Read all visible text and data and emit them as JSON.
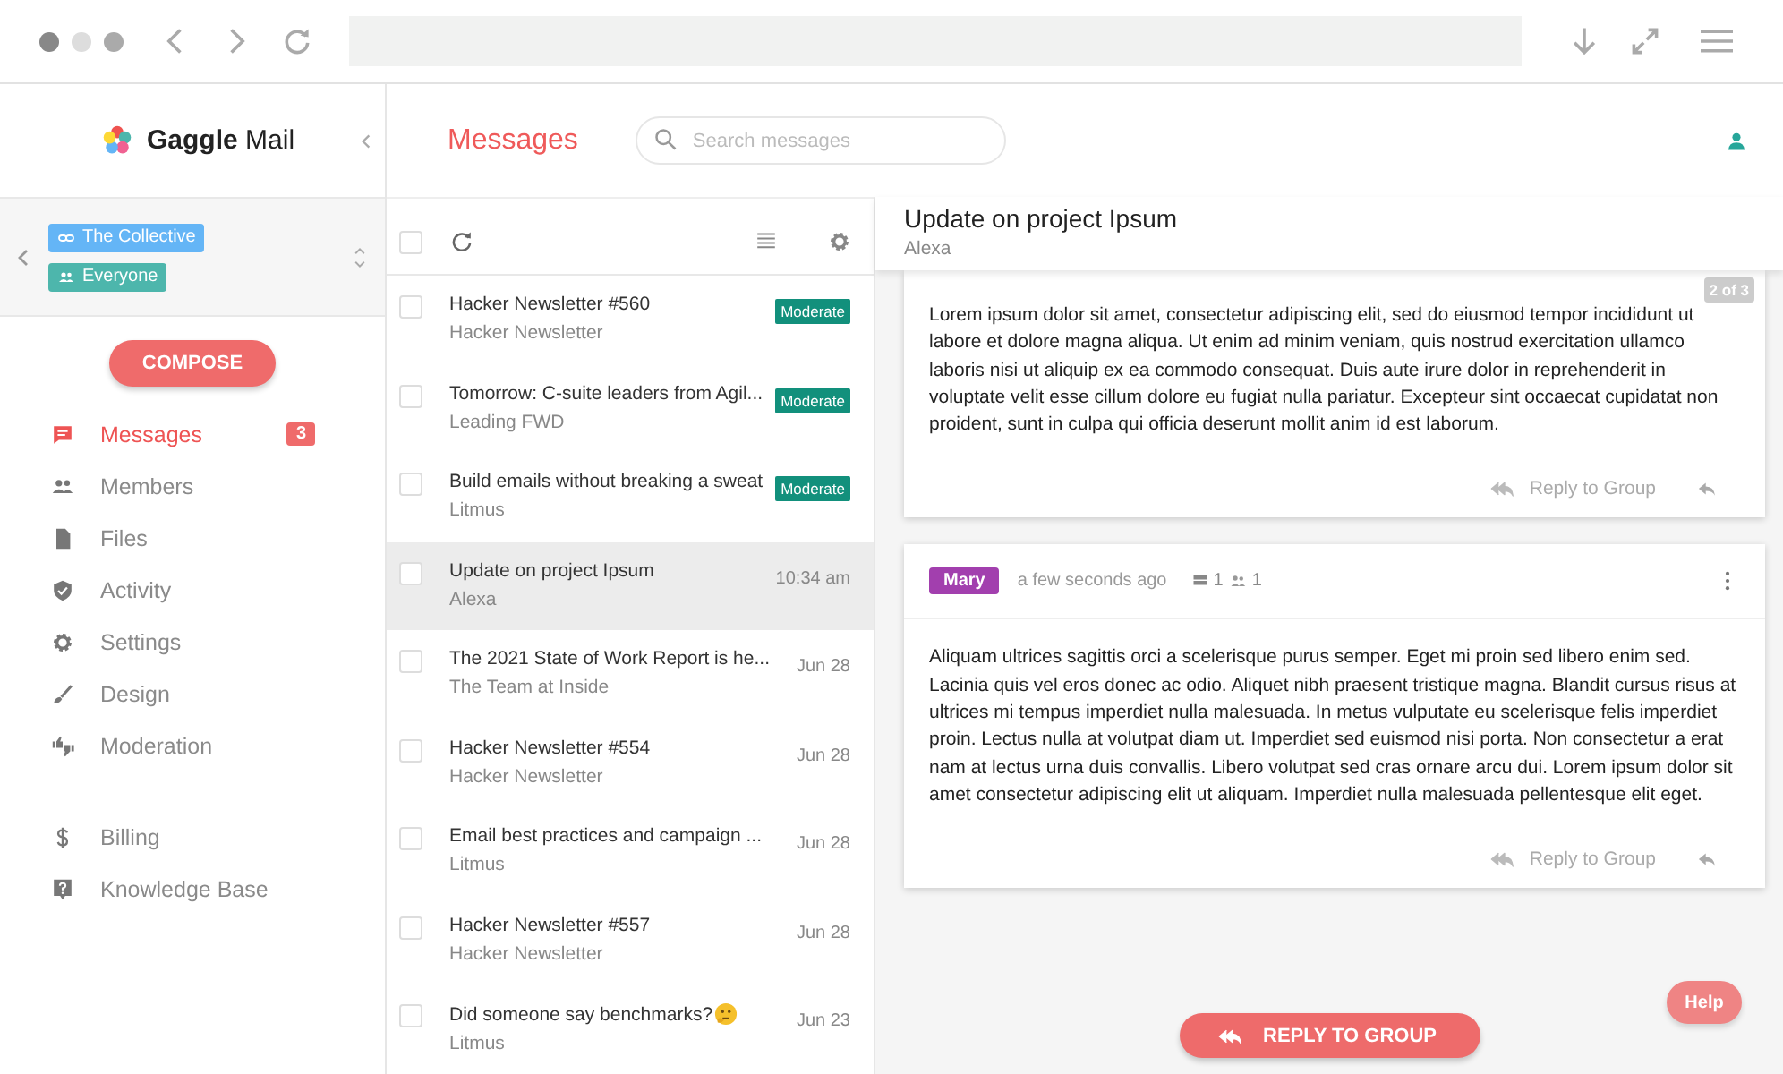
{
  "sidebar": {
    "logo": "**Gaggle** Mail",
    "groups": [
      {
        "label": "The Collective",
        "kind": "link",
        "color": "#64b5f6"
      },
      {
        "label": "Everyone",
        "kind": "people",
        "color": "#4db6ac"
      }
    ],
    "compose": "COMPOSE",
    "nav": [
      {
        "label": "Messages",
        "kind": "message",
        "selected": true,
        "badge": "3"
      },
      {
        "label": "Members",
        "kind": "people",
        "selected": false
      },
      {
        "label": "Files",
        "kind": "file",
        "selected": false
      },
      {
        "label": "Activity",
        "kind": "shield",
        "selected": false
      },
      {
        "label": "Settings",
        "kind": "gear",
        "selected": false
      },
      {
        "label": "Design",
        "kind": "brush",
        "selected": false
      },
      {
        "label": "Moderation",
        "kind": "thumbs",
        "selected": false
      }
    ],
    "nav_secondary": [
      {
        "label": "Billing",
        "kind": "dollar",
        "selected": false
      },
      {
        "label": "Knowledge Base",
        "kind": "help",
        "selected": false
      }
    ]
  },
  "topbar": {
    "title": "Messages",
    "search": {
      "placeholder": "Search messages"
    }
  },
  "message_list": {
    "select_all": {
      "checked": false
    },
    "rows": [
      {
        "subject": "Hacker Newsletter #560",
        "sender": "Hacker Newsletter",
        "tag": "Moderate",
        "checked": false,
        "selected": false
      },
      {
        "subject": "Tomorrow: C-suite leaders from Agil...",
        "sender": "Leading FWD",
        "tag": "Moderate",
        "checked": false,
        "selected": false
      },
      {
        "subject": "Build emails without breaking a sweat",
        "sender": "Litmus",
        "tag": "Moderate",
        "checked": false,
        "selected": false
      },
      {
        "subject": "Update on project Ipsum",
        "sender": "Alexa",
        "time": "10:34 am",
        "checked": false,
        "selected": true
      },
      {
        "subject": "The 2021 State of Work Report is he...",
        "sender": "The Team at Inside",
        "time": "Jun 28",
        "checked": false,
        "selected": false
      },
      {
        "subject": "Hacker Newsletter #554",
        "sender": "Hacker Newsletter",
        "time": "Jun 28",
        "checked": false,
        "selected": false
      },
      {
        "subject": "Email best practices and campaign ...",
        "sender": "Litmus",
        "time": "Jun 28",
        "checked": false,
        "selected": false
      },
      {
        "subject": "Hacker Newsletter #557",
        "sender": "Hacker Newsletter",
        "time": "Jun 28",
        "checked": false,
        "selected": false
      },
      {
        "subject": "Did someone say benchmarks?",
        "sender": "Litmus",
        "time": "Jun 23",
        "emoji": true,
        "checked": false,
        "selected": false
      }
    ]
  },
  "thread": {
    "subject": "Update on project Ipsum",
    "sender": "Alexa",
    "messages": [
      {
        "counter": "2 of 3",
        "body": "Lorem ipsum dolor sit amet, consectetur adipiscing elit, sed do eiusmod tempor incididunt ut labore et dolore magna aliqua. Ut enim ad minim veniam, quis nostrud exercitation ullamco laboris nisi ut aliquip ex ea commodo consequat. Duis aute irure dolor in reprehenderit in voluptate velit esse cillum dolore eu fugiat nulla pariatur. Excepteur sint occaecat cupidatat non proident, sunt in culpa qui officia deserunt mollit anim id est laborum.",
        "reply_group": "Reply to Group"
      },
      {
        "author": "Mary",
        "color": "#a23fae",
        "time": "a few seconds ago",
        "message_count": "1",
        "member_count": "1",
        "body": "Aliquam ultrices sagittis orci a scelerisque purus semper. Eget mi proin sed libero enim sed. Lacinia quis vel eros donec ac odio. Aliquet nibh praesent tristique magna. Blandit cursus risus at ultrices mi tempus imperdiet nulla malesuada. In metus vulputate eu scelerisque felis imperdiet proin. Lectus nulla at volutpat diam ut. Imperdiet sed euismod nisi porta. Non consectetur a erat nam at lectus urna duis convallis. Libero volutpat sed cras ornare arcu dui. Lorem ipsum dolor sit amet consectetur adipiscing elit ut aliquam. Imperdiet nulla malesuada pellentesque elit eget.",
        "reply_group": "Reply to Group"
      }
    ]
  },
  "reply_button": "REPLY TO GROUP",
  "help_button": "Help"
}
